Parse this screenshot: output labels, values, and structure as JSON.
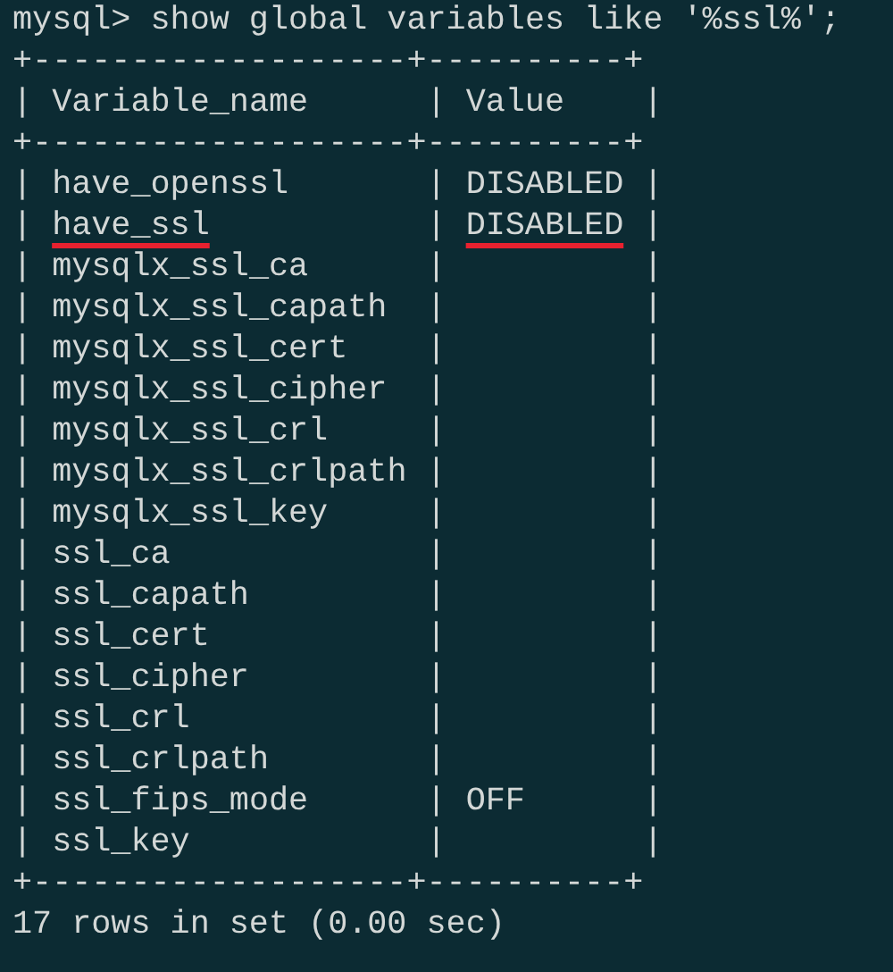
{
  "command": "mysql> show global variables like '%ssl%';",
  "table": {
    "border": "+-------------------+----------+",
    "separator": "|",
    "columns": [
      "Variable_name",
      "Value"
    ],
    "rows": [
      {
        "cells": [
          "have_openssl",
          "DISABLED"
        ],
        "marked": false
      },
      {
        "cells": [
          "have_ssl",
          "DISABLED"
        ],
        "marked": true
      },
      {
        "cells": [
          "mysqlx_ssl_ca",
          ""
        ],
        "marked": false
      },
      {
        "cells": [
          "mysqlx_ssl_capath",
          ""
        ],
        "marked": false
      },
      {
        "cells": [
          "mysqlx_ssl_cert",
          ""
        ],
        "marked": false
      },
      {
        "cells": [
          "mysqlx_ssl_cipher",
          ""
        ],
        "marked": false
      },
      {
        "cells": [
          "mysqlx_ssl_crl",
          ""
        ],
        "marked": false
      },
      {
        "cells": [
          "mysqlx_ssl_crlpath",
          ""
        ],
        "marked": false
      },
      {
        "cells": [
          "mysqlx_ssl_key",
          ""
        ],
        "marked": false
      },
      {
        "cells": [
          "ssl_ca",
          ""
        ],
        "marked": false
      },
      {
        "cells": [
          "ssl_capath",
          ""
        ],
        "marked": false
      },
      {
        "cells": [
          "ssl_cert",
          ""
        ],
        "marked": false
      },
      {
        "cells": [
          "ssl_cipher",
          ""
        ],
        "marked": false
      },
      {
        "cells": [
          "ssl_crl",
          ""
        ],
        "marked": false
      },
      {
        "cells": [
          "ssl_crlpath",
          ""
        ],
        "marked": false
      },
      {
        "cells": [
          "ssl_fips_mode",
          "OFF"
        ],
        "marked": false
      },
      {
        "cells": [
          "ssl_key",
          ""
        ],
        "marked": false
      }
    ]
  },
  "result": "17 rows in set (0.00 sec)"
}
